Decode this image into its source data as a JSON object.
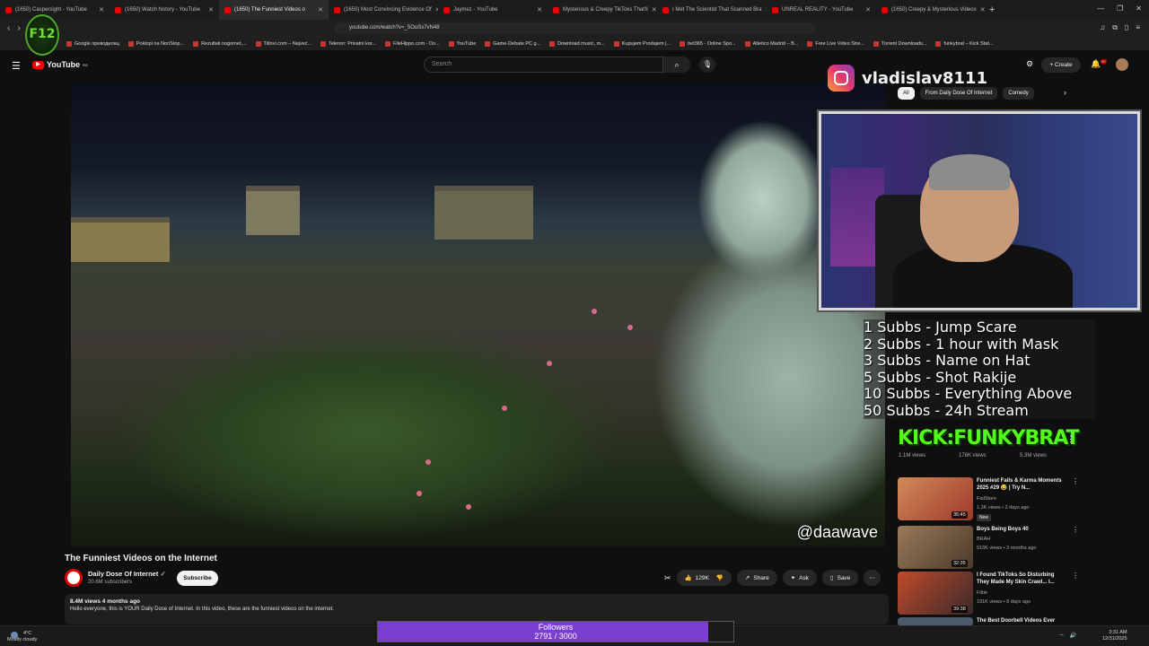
{
  "browser": {
    "tabs": [
      {
        "label": "(1650) Caspersight - YouTube",
        "active": false
      },
      {
        "label": "(1650) Watch history - YouTube",
        "active": false
      },
      {
        "label": "(1650) The Funniest Videos o",
        "active": true
      },
      {
        "label": "(1650) Most Convincing Evidence Of",
        "active": false
      },
      {
        "label": "Jaymez - YouTube",
        "active": false
      },
      {
        "label": "Mysterious & Creepy TikToks That'll",
        "active": false
      },
      {
        "label": "I Met The Scientist That Scanned Bra",
        "active": false
      },
      {
        "label": "UNREAL REALITY - YouTube",
        "active": false
      },
      {
        "label": "(1650) Creepy & Mysterious Videos",
        "active": false
      }
    ],
    "url": "youtube.com/watch?v=_5OuSx7vN48",
    "bookmarks": [
      "Google преводилац",
      "Poklopi na NonStop...",
      "Rezultati nogomet,...",
      "Titlovi.com – Najveć...",
      "Telenor: Privatni kor...",
      "FileHippo.com - Do...",
      "YouTube",
      "Game-Debate PC g...",
      "Download music, m...",
      "Kupujem Prodajem |...",
      "bet365 - Online Spo...",
      "Atletico Madrid – B...",
      "Free Live Video Stre...",
      "Torrent Downloads...",
      "funkybrat – Kick Stat..."
    ]
  },
  "overlay": {
    "logo_text": "F12",
    "instagram_handle": "vladislav8111",
    "rewards": [
      "1 Subbs - Jump Scare",
      "2 Subbs - 1 hour with Mask",
      "3 Subbs - Name on Hat",
      "5 Subbs - Shot Rakije",
      "10 Subbs - Everything Above",
      "50 Subbs - 24h Stream"
    ],
    "kick_text": "KICK:FUNKYBRAT",
    "followers": {
      "label": "Followers",
      "count": "2791 / 3000",
      "current": 2791,
      "goal": 3000
    }
  },
  "youtube": {
    "logo": "YouTube",
    "country": "RS",
    "search_placeholder": "Search",
    "create_label": "Create",
    "notif_count": "9+",
    "video": {
      "watermark": "@daawave",
      "title": "The Funniest Videos on the Internet",
      "channel": "Daily Dose Of Internet",
      "subscribers": "20.6M subscribers",
      "subscribe_label": "Subscribe",
      "likes": "129K",
      "share_label": "Share",
      "ask_label": "Ask",
      "save_label": "Save",
      "views_age": "8.4M views  4 months ago",
      "description": "Hello everyone, this is YOUR Daily Dose of Internet. In this video, these are the funniest videos on the internet."
    },
    "chips": [
      "All",
      "From Daily Dose Of Internet",
      "Comedy"
    ],
    "shorts_stats": [
      "1.1M views",
      "178K views",
      "5.3M views"
    ],
    "recommendations": [
      {
        "title": "Funniest Fails & Karma Moments 2025 #29 😂 | Try N...",
        "channel": "FailStore",
        "views": "1.3K views • 2 days ago",
        "duration": "35:45",
        "badge": "New",
        "color": "#c05a3a"
      },
      {
        "title": "Boys Being Boys 40",
        "channel": "BRAH",
        "views": "516K views • 3 months ago",
        "duration": "32:35",
        "badge": "",
        "color": "#7a5a3a"
      },
      {
        "title": "I Found TikToks So Disturbing They Made My Skin Crawl... I...",
        "channel": "Fittie",
        "views": "191K views • 8 days ago",
        "duration": "39:38",
        "badge": "",
        "color": "#b03a2a"
      },
      {
        "title": "The Best Doorbell Videos Ever",
        "channel": "",
        "views": "",
        "duration": "",
        "badge": "",
        "color": "#4a5a6a"
      }
    ]
  },
  "taskbar": {
    "temp": "4°C",
    "weather": "Mostly cloudy",
    "time": "3:31 AM",
    "date": "12/31/2025"
  },
  "colors": {
    "accent": "#ff0000",
    "kick_green": "#53fc18",
    "followers_bar": "#7b3fd0"
  }
}
